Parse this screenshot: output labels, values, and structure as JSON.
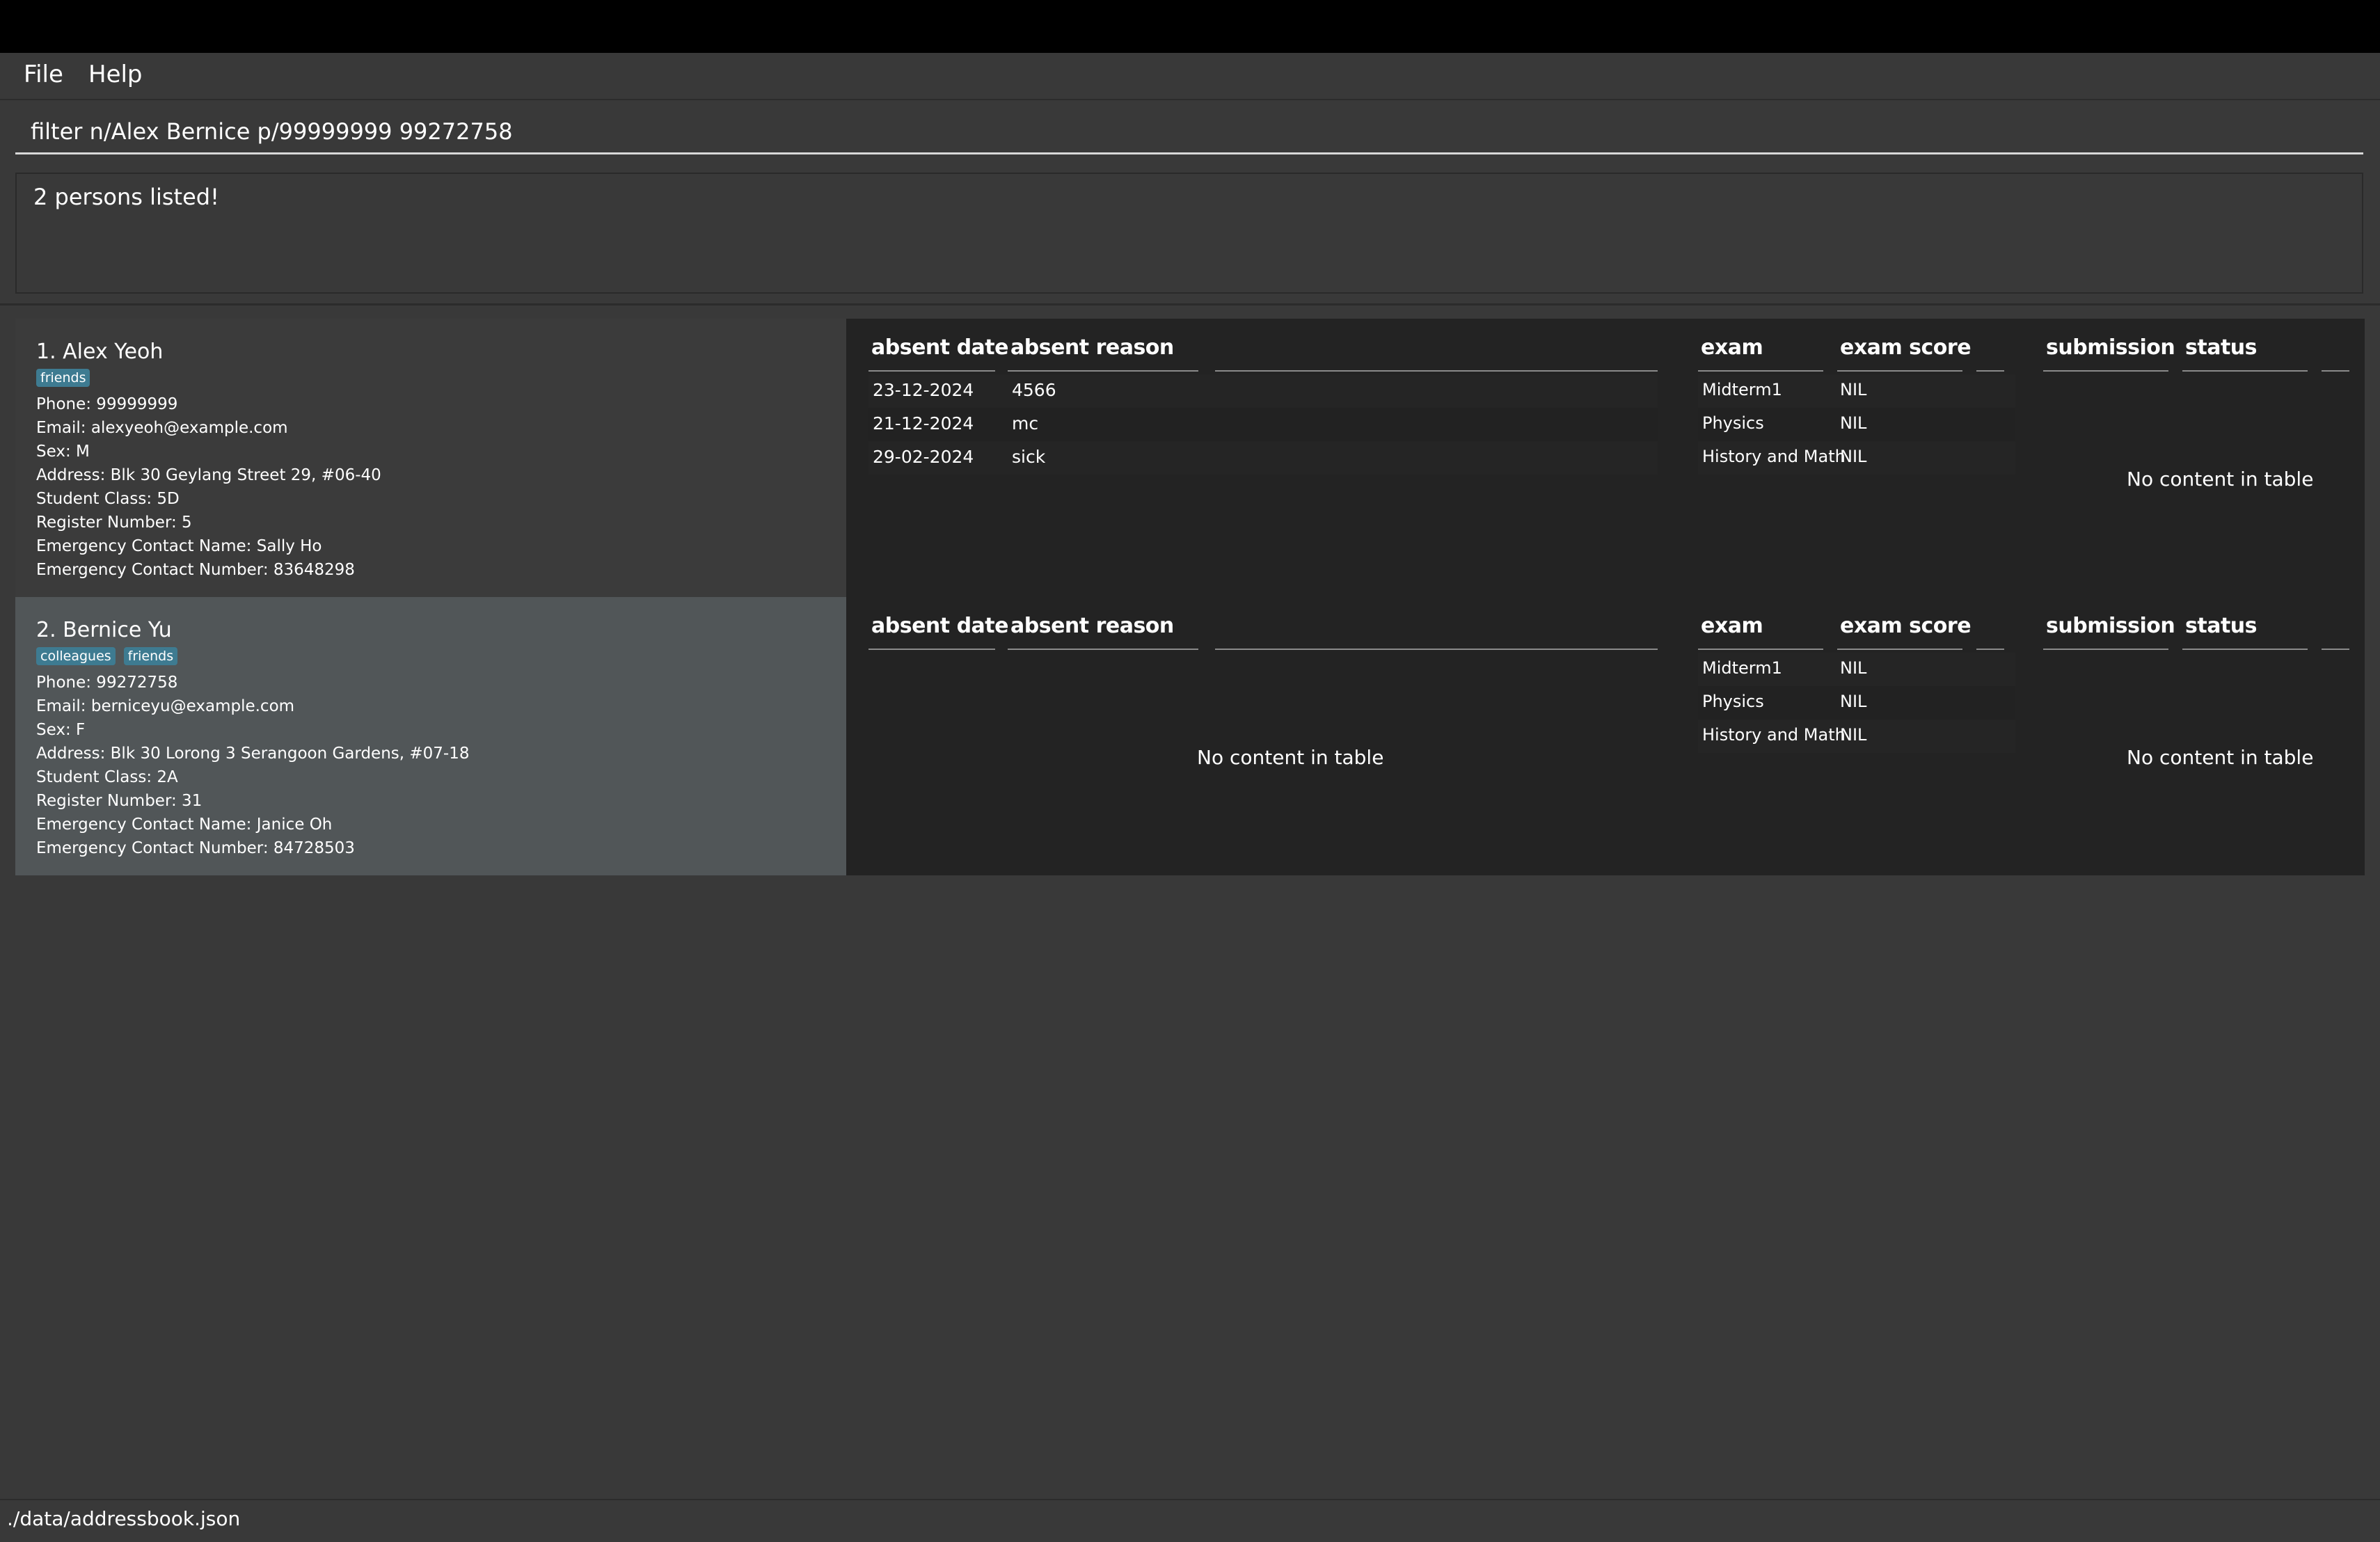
{
  "menu": {
    "file": "File",
    "help": "Help"
  },
  "command": {
    "value": "filter n/Alex Bernice p/99999999 99272758"
  },
  "result": {
    "text": "2 persons listed!"
  },
  "persons": [
    {
      "name": "1. Alex Yeoh",
      "tags": [
        "friends"
      ],
      "phone": "Phone: 99999999",
      "email": "Email: alexyeoh@example.com",
      "sex": "Sex: M",
      "address": "Address: Blk 30 Geylang Street 29, #06-40",
      "student_class": "Student Class: 5D",
      "register_number": "Register Number: 5",
      "emergency_name": "Emergency Contact Name: Sally Ho",
      "emergency_number": "Emergency Contact Number: 83648298",
      "attendance": [
        {
          "date": "23-12-2024",
          "reason": "4566"
        },
        {
          "date": "21-12-2024",
          "reason": "mc"
        },
        {
          "date": "29-02-2024",
          "reason": "sick"
        }
      ],
      "exams": [
        {
          "exam": "Midterm1",
          "score": "NIL"
        },
        {
          "exam": "Physics",
          "score": "NIL"
        },
        {
          "exam": "History and Math",
          "score": "NIL"
        }
      ]
    },
    {
      "name": "2. Bernice Yu",
      "tags": [
        "colleagues",
        "friends"
      ],
      "phone": "Phone: 99272758",
      "email": "Email: berniceyu@example.com",
      "sex": "Sex: F",
      "address": "Address: Blk 30 Lorong 3 Serangoon Gardens, #07-18",
      "student_class": "Student Class: 2A",
      "register_number": "Register Number: 31",
      "emergency_name": "Emergency Contact Name: Janice Oh",
      "emergency_number": "Emergency Contact Number: 84728503",
      "attendance": [],
      "exams": [
        {
          "exam": "Midterm1",
          "score": "NIL"
        },
        {
          "exam": "Physics",
          "score": "NIL"
        },
        {
          "exam": "History and Math",
          "score": "NIL"
        }
      ]
    }
  ],
  "table_headers": {
    "absent_date": "absent date",
    "absent_reason": "absent reason",
    "exam": "exam",
    "exam_score": "exam score",
    "submission": "submission",
    "status": "status"
  },
  "empty_table_text": "No content in table",
  "status_bar": {
    "path": "./data/addressbook.json"
  }
}
